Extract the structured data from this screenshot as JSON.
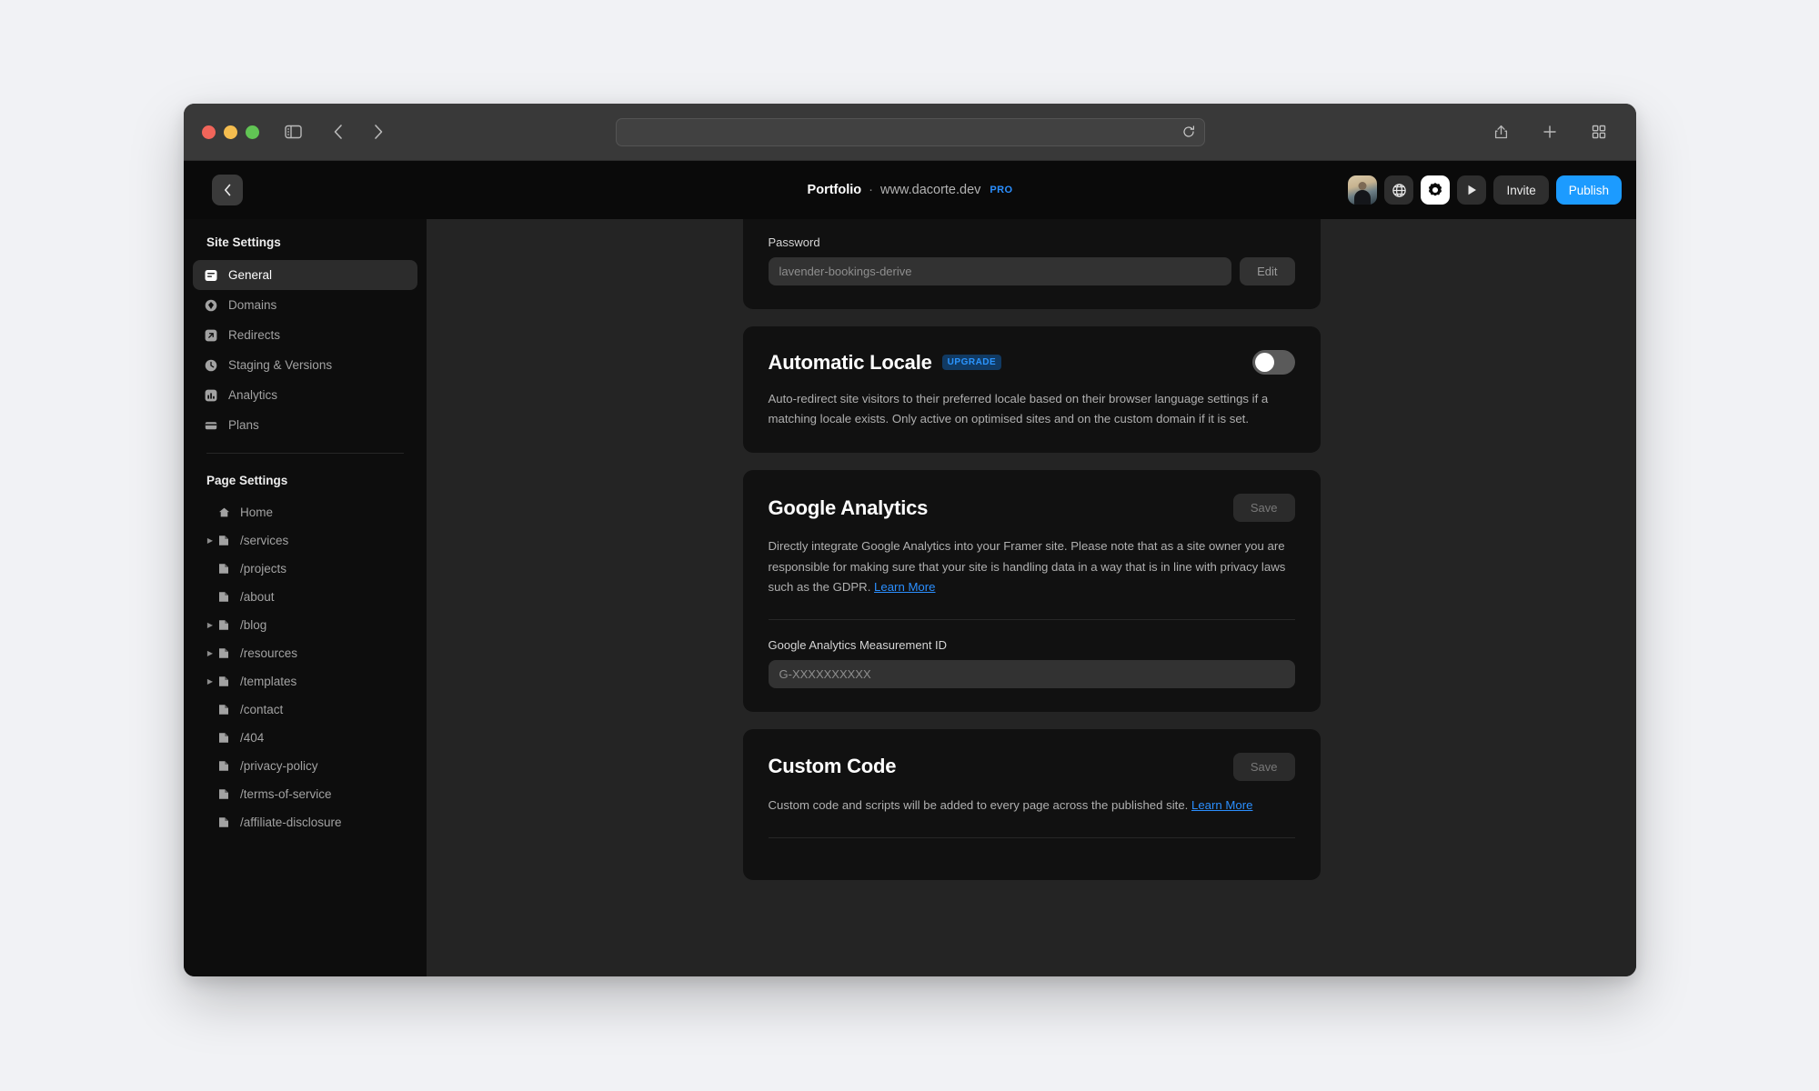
{
  "browser": {
    "traffic_lights": [
      "close",
      "minimize",
      "maximize"
    ],
    "url_value": "",
    "url_placeholder": "",
    "icons": {
      "sidebar_toggle": "sidebar-toggle-icon",
      "back": "chevron-left-icon",
      "forward": "chevron-right-icon",
      "reload": "reload-icon",
      "share": "share-icon",
      "new_tab": "plus-icon",
      "tab_overview": "tab-grid-icon"
    }
  },
  "app_header": {
    "back_label": "‹",
    "site_name": "Portfolio",
    "separator": "·",
    "site_url": "www.dacorte.dev",
    "plan_badge": "PRO",
    "invite_label": "Invite",
    "publish_label": "Publish",
    "icons": {
      "avatar": "user-avatar",
      "globe": "globe-icon",
      "settings": "gear-icon",
      "preview": "play-icon"
    }
  },
  "sidebar": {
    "site_settings_title": "Site Settings",
    "site_items": [
      {
        "label": "General",
        "icon": "general-icon",
        "active": true
      },
      {
        "label": "Domains",
        "icon": "domains-icon",
        "active": false
      },
      {
        "label": "Redirects",
        "icon": "redirects-icon",
        "active": false
      },
      {
        "label": "Staging & Versions",
        "icon": "clock-icon",
        "active": false
      },
      {
        "label": "Analytics",
        "icon": "analytics-icon",
        "active": false
      },
      {
        "label": "Plans",
        "icon": "plans-icon",
        "active": false
      }
    ],
    "page_settings_title": "Page Settings",
    "page_items": [
      {
        "label": "Home",
        "icon": "home-icon",
        "expandable": false
      },
      {
        "label": "/services",
        "icon": "page-icon",
        "expandable": true
      },
      {
        "label": "/projects",
        "icon": "page-icon",
        "expandable": false
      },
      {
        "label": "/about",
        "icon": "page-icon",
        "expandable": false
      },
      {
        "label": "/blog",
        "icon": "page-icon",
        "expandable": true
      },
      {
        "label": "/resources",
        "icon": "page-icon",
        "expandable": true
      },
      {
        "label": "/templates",
        "icon": "page-icon",
        "expandable": true
      },
      {
        "label": "/contact",
        "icon": "page-icon",
        "expandable": false
      },
      {
        "label": "/404",
        "icon": "page-icon",
        "expandable": false
      },
      {
        "label": "/privacy-policy",
        "icon": "page-icon",
        "expandable": false
      },
      {
        "label": "/terms-of-service",
        "icon": "page-icon",
        "expandable": false
      },
      {
        "label": "/affiliate-disclosure",
        "icon": "page-icon",
        "expandable": false
      }
    ]
  },
  "main": {
    "password_card": {
      "label": "Password",
      "value": "lavender-bookings-derive",
      "edit_label": "Edit"
    },
    "automatic_locale_card": {
      "title": "Automatic Locale",
      "badge": "UPGRADE",
      "toggle_on": false,
      "description": "Auto-redirect site visitors to their preferred locale based on their browser language settings if a matching locale exists. Only active on optimised sites and on the custom domain if it is set."
    },
    "google_analytics_card": {
      "title": "Google Analytics",
      "save_label": "Save",
      "description": "Directly integrate Google Analytics into your Framer site. Please note that as a site owner you are responsible for making sure that your site is handling data in a way that is in line with privacy laws such as the GDPR. ",
      "learn_more": "Learn More",
      "field_label": "Google Analytics Measurement ID",
      "field_placeholder": "G-XXXXXXXXXX"
    },
    "custom_code_card": {
      "title": "Custom Code",
      "save_label": "Save",
      "description": "Custom code and scripts will be added to every page across the published site. ",
      "learn_more": "Learn More"
    }
  },
  "colors": {
    "accent": "#1c9bff",
    "link": "#2b8fff",
    "card_bg": "#111111",
    "main_bg": "#242424",
    "sidebar_bg": "#0d0d0d",
    "header_bg": "#0a0a0a"
  }
}
